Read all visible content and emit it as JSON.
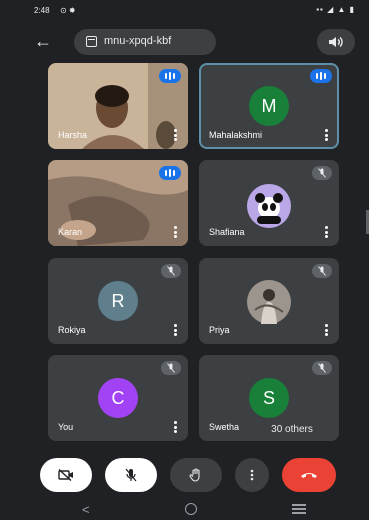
{
  "status_bar": {
    "time": "2:48",
    "time_icons": "⊙ ✸",
    "right_icons": "▪▪ ◢ ▲ ▮"
  },
  "header": {
    "meeting_code": "mnu-xpqd-kbf",
    "back_icon": "arrow-left-icon",
    "speaker_icon": "speaker-icon"
  },
  "participants": [
    {
      "name": "Harsha",
      "kind": "photo",
      "speaking": true
    },
    {
      "name": "Mahalakshmi",
      "kind": "letter",
      "letter": "M",
      "color": "#188038",
      "speaking": true,
      "active": true
    },
    {
      "name": "Karan",
      "kind": "photo",
      "speaking": true
    },
    {
      "name": "Shafiana",
      "kind": "avatar-image",
      "muted": true
    },
    {
      "name": "Rokiya",
      "kind": "letter",
      "letter": "R",
      "color": "#5f7f8c",
      "muted": true
    },
    {
      "name": "Priya",
      "kind": "avatar-image",
      "muted": true
    },
    {
      "name": "You",
      "kind": "letter",
      "letter": "C",
      "color": "#a142f4",
      "muted": true
    },
    {
      "name": "Swetha",
      "kind": "letter",
      "letter": "S",
      "color": "#188038",
      "muted": true
    }
  ],
  "others_count": "30 others",
  "controls": {
    "camera": "camera-off-icon",
    "mic": "mic-off-icon",
    "hand": "raise-hand-icon",
    "more": "more-vertical-icon",
    "end": "end-call-icon",
    "end_color": "#ea4335"
  },
  "navbar": {
    "back": "<"
  }
}
